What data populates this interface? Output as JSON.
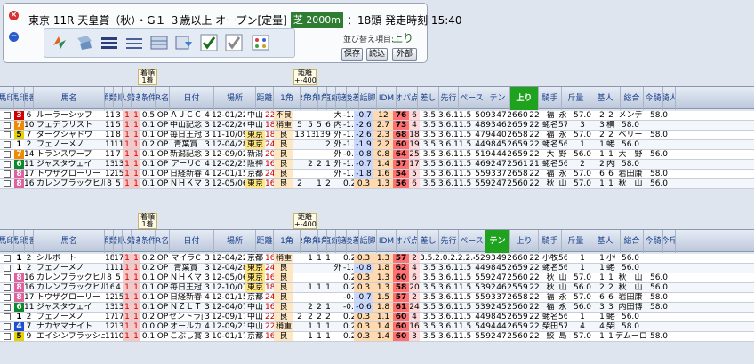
{
  "race": {
    "title": "東京 11R 天皇賞（秋）・G１ ３歳以上 オープン[定量]",
    "distance": "芝 2000m",
    "info": "：18頭 発走時刻 15:40"
  },
  "sort": {
    "label": "並び替え項目:",
    "value": "上り"
  },
  "buttons": {
    "save": "保存",
    "load": "読込",
    "external": "外部"
  },
  "header_notes": {
    "arrival": [
      "着順",
      "1着"
    ],
    "distance": [
      "距離",
      "+-400"
    ]
  },
  "columns1": [
    "馬印",
    "馬印",
    "馬番",
    "馬名",
    "頭数",
    "着順",
    "人気",
    "着差",
    "条件",
    "R名",
    "日付",
    "場所",
    "距離",
    "1角",
    "2角",
    "3角",
    "4角",
    "直線",
    "前差",
    "後差",
    "話脚",
    "IDM",
    "オパ点",
    "差し",
    "先行",
    "ペース",
    "テン",
    "上り",
    "騎手",
    "斤量",
    "基人",
    "総合",
    "今騎",
    "騎人"
  ],
  "columns2": [
    "馬印",
    "馬印",
    "馬番",
    "馬名",
    "頭数",
    "着順",
    "人気",
    "着差",
    "条件",
    "R名",
    "日付",
    "場所",
    "距離",
    "1角",
    "2角",
    "3角",
    "4角",
    "直線",
    "前差",
    "後差",
    "話脚",
    "IDM",
    "オパ点",
    "差し",
    "先行",
    "ペース",
    "テン",
    "上り",
    "騎手",
    "斤量",
    "基人",
    "総合",
    "今騎",
    "今斤"
  ],
  "top_rows": [
    [
      "3",
      "6",
      "ルーラーシップ",
      "11",
      "3",
      "1",
      "1",
      "0.5",
      "OP",
      "ＡＪＣＣ",
      "4",
      "12-01/22",
      "中山",
      "2200",
      "不良",
      "",
      "",
      "",
      "",
      "大",
      "-1.9",
      "-0.7",
      "12",
      "76",
      "6",
      "3.5.3.6.11.5",
      "50",
      "93",
      "47",
      "26",
      "60",
      "22",
      "福",
      "永",
      "57.0",
      "2",
      "2",
      "メンデ",
      "58.0"
    ],
    [
      "7",
      "10",
      "フェデラリスト",
      "11",
      "5",
      "1",
      "1",
      "0.1",
      "OP",
      "中山記念",
      "3",
      "12-02/26",
      "中山",
      "1800",
      "稍重",
      "5",
      "5",
      "5",
      "6",
      "内",
      "-1.5",
      "-2.6",
      "2.7",
      "73",
      "4",
      "3.5.3.6.11.5",
      "48",
      "93",
      "46",
      "26",
      "59",
      "22",
      "蛯名正",
      "57.0",
      "3",
      "3",
      "横山典",
      "58.0"
    ],
    [
      "5",
      "7",
      "ダークシャドウ",
      "11",
      "8",
      "1",
      "1",
      "0.1",
      "OP",
      "毎日王冠",
      "3",
      "11-10/09",
      "東京",
      "1800",
      "良",
      "13",
      "13",
      "13",
      "9",
      "外",
      "-1.2",
      "-2.6",
      "2.3",
      "68",
      "18",
      "3.5.3.6.11.5",
      "47",
      "94",
      "40",
      "26",
      "58",
      "22",
      "福",
      "永",
      "57.0",
      "2",
      "2",
      "ベリー",
      "58.0"
    ],
    [
      "1",
      "2",
      "フェノーメノ",
      "11",
      "11",
      "1",
      "1",
      "0.2",
      "OP",
      "青葉賞",
      "3",
      "12-04/28",
      "東京",
      "2400",
      "良",
      "",
      "",
      "",
      "2",
      "外",
      "-1.5",
      "-1.9",
      "2.2",
      "60",
      "19",
      "3.5.3.6.11.5",
      "44",
      "98",
      "45",
      "26",
      "59",
      "22",
      "蛯名正",
      "56.0",
      "1",
      "1",
      "蛯名正",
      "56.0"
    ],
    [
      "7",
      "14",
      "トランスワープ",
      "11",
      "7",
      "1",
      "1",
      "0.1",
      "OP",
      "新潟記念",
      "3",
      "12-09/02",
      "新潟",
      "2000",
      "良",
      "",
      "",
      "",
      "",
      "外",
      "-0.9",
      "-0.8",
      "0.8",
      "64",
      "25",
      "3.5.3.6.11.5",
      "51",
      "94",
      "44",
      "26",
      "59",
      "22",
      "大",
      "野",
      "56.0",
      "1",
      "1",
      "大　野",
      "56.0"
    ],
    [
      "6",
      "11",
      "ジャスタウェイ",
      "13",
      "13",
      "1",
      "1",
      "0.1",
      "OP",
      "アーリC",
      "4",
      "12-02/25",
      "阪神",
      "1600",
      "良",
      "",
      "2",
      "2",
      "1",
      "外",
      "-1.2",
      "-0.7",
      "1.4",
      "57",
      "17",
      "3.5.3.6.11.5",
      "46",
      "92",
      "47",
      "25",
      "61",
      "21",
      "蛯名正",
      "56.0",
      "2",
      "2",
      "内田博",
      "58.0"
    ],
    [
      "8",
      "17",
      "トウザグローリー",
      "12",
      "15",
      "1",
      "1",
      "0.1",
      "OP",
      "日経新春",
      "4",
      "12-01/15",
      "京都",
      "2400",
      "良",
      "",
      "",
      "",
      "",
      "外",
      "-1.1",
      "-1.8",
      "1.6",
      "54",
      "5",
      "3.5.3.6.11.5",
      "55",
      "93",
      "37",
      "26",
      "58",
      "22",
      "福",
      "永",
      "57.0",
      "6",
      "6",
      "岩田康",
      "58.0"
    ],
    [
      "8",
      "16",
      "カレンブラックヒル",
      "8",
      "5",
      "1",
      "1",
      "0.1",
      "OP",
      "ＮＨＫマ",
      "3",
      "12-05/06",
      "東京",
      "1600",
      "良",
      "2",
      "",
      "1",
      "2",
      "",
      "0.2",
      "0.3",
      "1.3",
      "56",
      "6",
      "3.5.3.6.11.5",
      "55",
      "92",
      "47",
      "25",
      "60",
      "22",
      "秋",
      "山",
      "57.0",
      "1",
      "1",
      "秋　山",
      "56.0"
    ]
  ],
  "bottom_rows": [
    [
      "1",
      "2",
      "シルポート",
      "18",
      "17",
      "1",
      "1",
      "0.2",
      "OP",
      "マイラC",
      "3",
      "12-04/22",
      "京都",
      "1600",
      "稍重",
      "",
      "1",
      "1",
      "1",
      "",
      "0.2",
      "0.3",
      "1.3",
      "57",
      "2",
      "3.5.2.0.2.2.2.4",
      "52",
      "93",
      "49",
      "26",
      "60",
      "22",
      "小牧太",
      "56.0",
      "1",
      "1",
      "小牧太",
      "56.0"
    ],
    [
      "1",
      "2",
      "フェノーメノ",
      "11",
      "11",
      "1",
      "1",
      "0.2",
      "OP",
      "青葉賞",
      "3",
      "12-04/28",
      "東京",
      "2400",
      "良",
      "",
      "",
      "",
      "",
      "外",
      "-1.1",
      "-0.8",
      "1.8",
      "62",
      "4",
      "3.5.3.6.11.5",
      "44",
      "98",
      "45",
      "26",
      "59",
      "22",
      "蛯名正",
      "56.0",
      "1",
      "1",
      "蛯名正",
      "56.0"
    ],
    [
      "8",
      "16",
      "カレンブラックヒル",
      "8",
      "5",
      "1",
      "1",
      "0.1",
      "OP",
      "ＮＨＫマ",
      "3",
      "12-05/06",
      "東京",
      "1600",
      "良",
      "",
      "",
      "",
      "",
      "",
      "0.2",
      "0.3",
      "1.3",
      "60",
      "6",
      "3.5.3.6.11.5",
      "55",
      "92",
      "47",
      "25",
      "60",
      "22",
      "秋",
      "山",
      "57.0",
      "1",
      "1",
      "秋　山",
      "56.0"
    ],
    [
      "8",
      "16",
      "カレンブラックヒル",
      "16",
      "4",
      "1",
      "1",
      "0.1",
      "OP",
      "毎日王冠",
      "3",
      "12-10/07",
      "東京",
      "1800",
      "良",
      "",
      "1",
      "1",
      "1",
      "",
      "0.2",
      "0.3",
      "1.3",
      "58",
      "20",
      "3.5.3.6.11.5",
      "53",
      "92",
      "46",
      "25",
      "59",
      "22",
      "秋",
      "山",
      "56.0",
      "2",
      "2",
      "秋　山",
      "56.0"
    ],
    [
      "8",
      "17",
      "トウザグローリー",
      "12",
      "15",
      "1",
      "1",
      "0.1",
      "OP",
      "日経新春",
      "4",
      "12-01/15",
      "京都",
      "2400",
      "良",
      "",
      "",
      "",
      "",
      "",
      "-0.4",
      "-0.7",
      "1.5",
      "57",
      "2",
      "3.5.3.6.11.5",
      "55",
      "93",
      "37",
      "26",
      "58",
      "22",
      "福",
      "永",
      "57.0",
      "6",
      "6",
      "岩田康",
      "58.0"
    ],
    [
      "6",
      "11",
      "ジャスタウェイ",
      "13",
      "13",
      "1",
      "1",
      "0.1",
      "OP",
      "ＮＺＬＴ",
      "3",
      "12-04/07",
      "中山",
      "1600",
      "良",
      "",
      "2",
      "2",
      "1",
      "",
      "-0.6",
      "-0.6",
      "1.8",
      "61",
      "24",
      "3.5.3.6.11.5",
      "53",
      "92",
      "45",
      "25",
      "60",
      "22",
      "福",
      "永",
      "56.0",
      "3",
      "3",
      "内田博",
      "58.0"
    ],
    [
      "1",
      "2",
      "フェノーメノ",
      "17",
      "17",
      "1",
      "1",
      "0.2",
      "OP",
      "セントラ記",
      "3",
      "12-09/17",
      "中山",
      "2200",
      "良",
      "2",
      "2",
      "2",
      "2",
      "",
      "0.2",
      "0.3",
      "1.1",
      "60",
      "4",
      "3.5.3.6.11.5",
      "44",
      "98",
      "45",
      "26",
      "59",
      "22",
      "蛯名正",
      "56.0",
      "1",
      "1",
      "蛯名正",
      "56.0"
    ],
    [
      "4",
      "7",
      "ナカヤマナイト",
      "12",
      "13",
      "1",
      "1",
      "0.0",
      "OP",
      "オールカ",
      "4",
      "12-09/23",
      "中山",
      "2200",
      "稍重",
      "",
      "1",
      "1",
      "1",
      "",
      "0.2",
      "0.3",
      "1.4",
      "60",
      "16",
      "3.5.3.6.11.5",
      "54",
      "94",
      "44",
      "26",
      "59",
      "22",
      "柴田善",
      "57.0",
      "4",
      "4",
      "柴田善",
      "58.0"
    ],
    [
      "5",
      "9",
      "エイシンフラッシュ",
      "11",
      "10",
      "1",
      "1",
      "0.1",
      "OP",
      "こぶし賞",
      "3",
      "10-01/17",
      "京都",
      "1600",
      "良",
      "",
      "1",
      "1",
      "1",
      "",
      "0.2",
      "0.3",
      "1.4",
      "60",
      "3",
      "3.5.3.6.11.5",
      "55",
      "92",
      "47",
      "25",
      "60",
      "22",
      "鮫",
      "島",
      "57.0",
      "1",
      "1",
      "デムーロ",
      "58.0"
    ]
  ],
  "colors": {
    "accent": "#1fa31f",
    "header_text": "#1a3f8a",
    "waku": [
      "#ffffff",
      "#000000",
      "#d00000",
      "#1f4fd0",
      "#e6d200",
      "#0a8a2a",
      "#f08a00",
      "#e060a0"
    ]
  }
}
